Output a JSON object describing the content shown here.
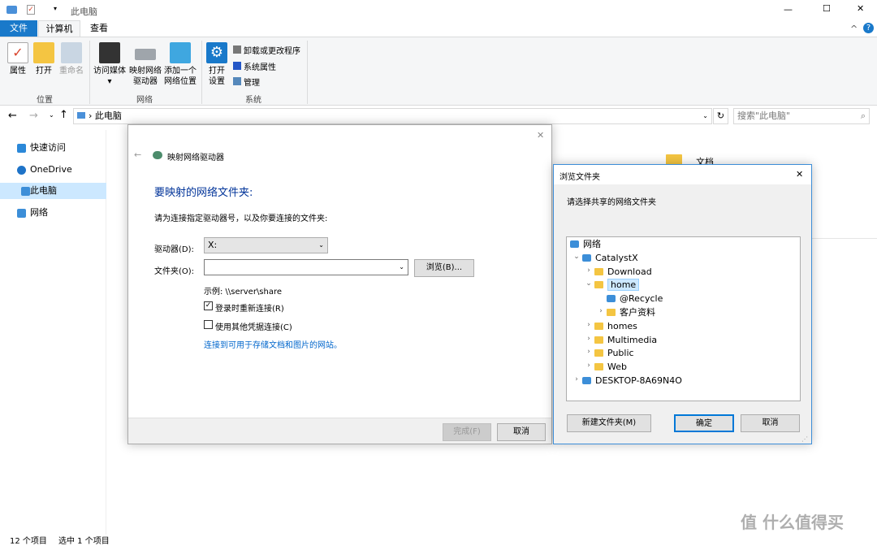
{
  "window": {
    "title": "此电脑",
    "minimize": "—",
    "maximize": "☐",
    "close": "✕",
    "help": "?",
    "collapse": "^"
  },
  "tabs": [
    {
      "label": "文件"
    },
    {
      "label": "计算机"
    },
    {
      "label": "查看"
    }
  ],
  "ribbon": {
    "groups": [
      {
        "label": "位置"
      },
      {
        "label": "网络"
      },
      {
        "label": "系统"
      }
    ],
    "buttons": [
      {
        "label": "属性"
      },
      {
        "label": "打开"
      },
      {
        "label": "重命名"
      },
      {
        "label": "访问媒体"
      },
      {
        "label": "映射网络\n驱动器"
      },
      {
        "label": "添加一个\n网络位置"
      },
      {
        "label": "打开\n设置"
      }
    ],
    "small": [
      {
        "label": "卸载或更改程序"
      },
      {
        "label": "系统属性"
      },
      {
        "label": "管理"
      }
    ]
  },
  "address": {
    "path": "此电脑",
    "search_placeholder": "搜索\"此电脑\""
  },
  "sidebar": {
    "items": [
      {
        "label": "快速访问",
        "color": "#2b88d8"
      },
      {
        "label": "OneDrive",
        "color": "#1e73c8"
      },
      {
        "label": "此电脑",
        "color": "#3c8ed8"
      },
      {
        "label": "网络",
        "color": "#3c8ed8"
      }
    ]
  },
  "content": {
    "background_item": "文档"
  },
  "status": {
    "count": "12 个项目",
    "selected": "选中 1 个项目"
  },
  "map_dialog": {
    "title": "映射网络驱动器",
    "heading": "要映射的网络文件夹:",
    "instruction": "请为连接指定驱动器号，以及你要连接的文件夹:",
    "drive_label": "驱动器(D):",
    "drive_value": "X:",
    "folder_label": "文件夹(O):",
    "folder_value": "",
    "browse": "浏览(B)...",
    "example": "示例: \\\\server\\share",
    "reconnect": "登录时重新连接(R)",
    "reconnect_checked": true,
    "other_cred": "使用其他凭据连接(C)",
    "other_cred_checked": false,
    "link": "连接到可用于存储文档和图片的网站。",
    "finish": "完成(F)",
    "cancel": "取消"
  },
  "browse_dialog": {
    "title": "浏览文件夹",
    "prompt": "请选择共享的网络文件夹",
    "tree": [
      {
        "label": "网络",
        "level": 0,
        "type": "net",
        "exp": ""
      },
      {
        "label": "CatalystX",
        "level": 1,
        "type": "net",
        "exp": "v"
      },
      {
        "label": "Download",
        "level": 2,
        "type": "folder",
        "exp": ">"
      },
      {
        "label": "home",
        "level": 2,
        "type": "folder",
        "exp": "v",
        "selected": true
      },
      {
        "label": "@Recycle",
        "level": 3,
        "type": "net",
        "exp": ""
      },
      {
        "label": "客户资料",
        "level": 3,
        "type": "folder",
        "exp": ">"
      },
      {
        "label": "homes",
        "level": 2,
        "type": "folder",
        "exp": ">"
      },
      {
        "label": "Multimedia",
        "level": 2,
        "type": "folder",
        "exp": ">"
      },
      {
        "label": "Public",
        "level": 2,
        "type": "folder",
        "exp": ">"
      },
      {
        "label": "Web",
        "level": 2,
        "type": "folder",
        "exp": ">"
      },
      {
        "label": "DESKTOP-8A69N4O",
        "level": 1,
        "type": "net",
        "exp": ">"
      }
    ],
    "new_folder": "新建文件夹(M)",
    "ok": "确定",
    "cancel": "取消"
  },
  "watermark": "值 什么值得买",
  "colors": {
    "accent": "#1979ca",
    "link": "#0066cc",
    "heading": "#003399"
  }
}
